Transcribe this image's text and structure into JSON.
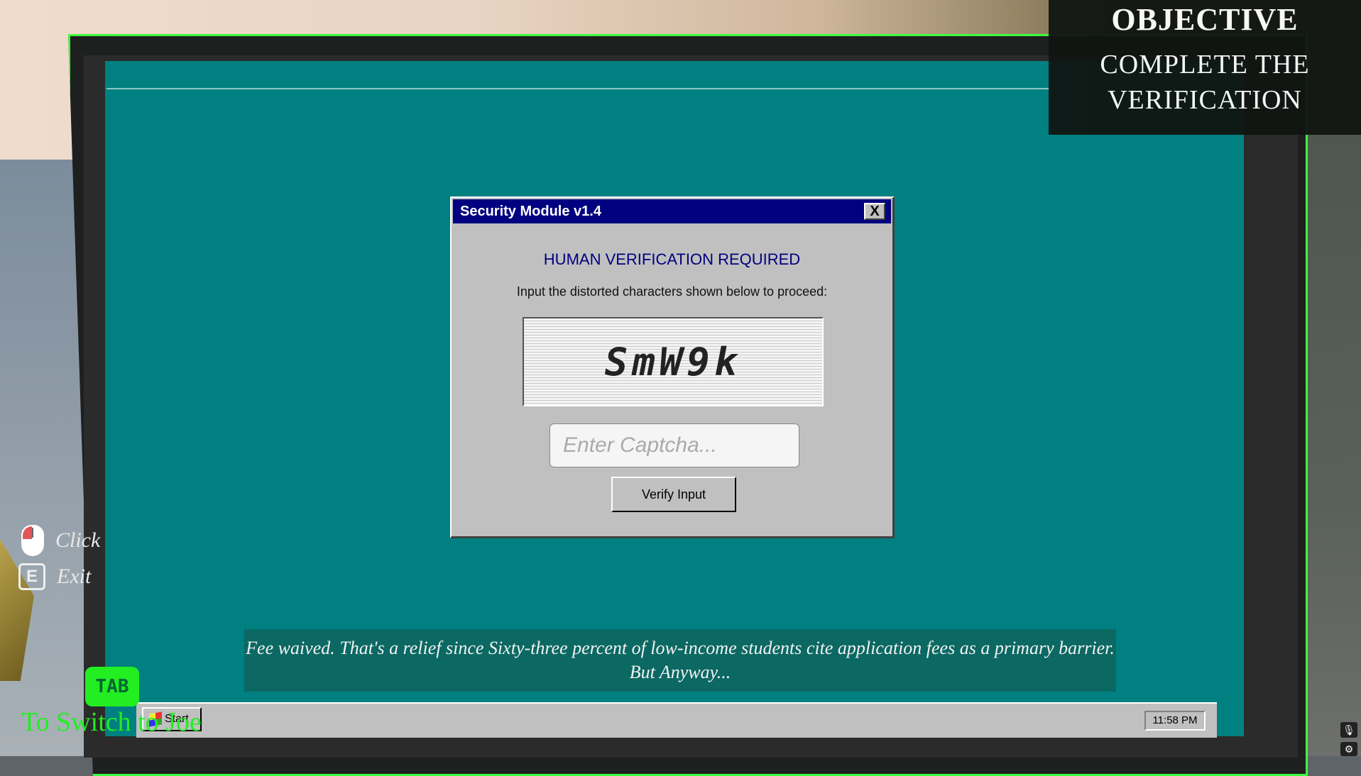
{
  "objective": {
    "title": "OBJECTIVE",
    "text": "COMPLETE THE VERIFICATION"
  },
  "dialog": {
    "title": "Security Module v1.4",
    "close_label": "X",
    "heading": "HUMAN VERIFICATION REQUIRED",
    "instruction": "Input the distorted characters shown below to proceed:",
    "captcha": "SmW9k",
    "input_value": "",
    "input_placeholder": "Enter Captcha...",
    "verify_label": "Verify Input"
  },
  "subtitle": "Fee waived. That's a relief since Sixty-three percent of low-income students cite application fees as a primary barrier. But Anyway...",
  "taskbar": {
    "start_label": "Start",
    "clock": "11:58 PM"
  },
  "hints": {
    "click_label": "Click",
    "exit_key": "E",
    "exit_label": "Exit",
    "tab_key": "TAB",
    "tab_label": "To Switch to Joe"
  },
  "colors": {
    "desktop": "#008080",
    "titlebar": "#000080",
    "highlight": "#22ee22"
  },
  "icons": [
    "mouse-icon",
    "e-key-icon",
    "windows-logo-icon",
    "microphone-icon",
    "settings-icon"
  ]
}
